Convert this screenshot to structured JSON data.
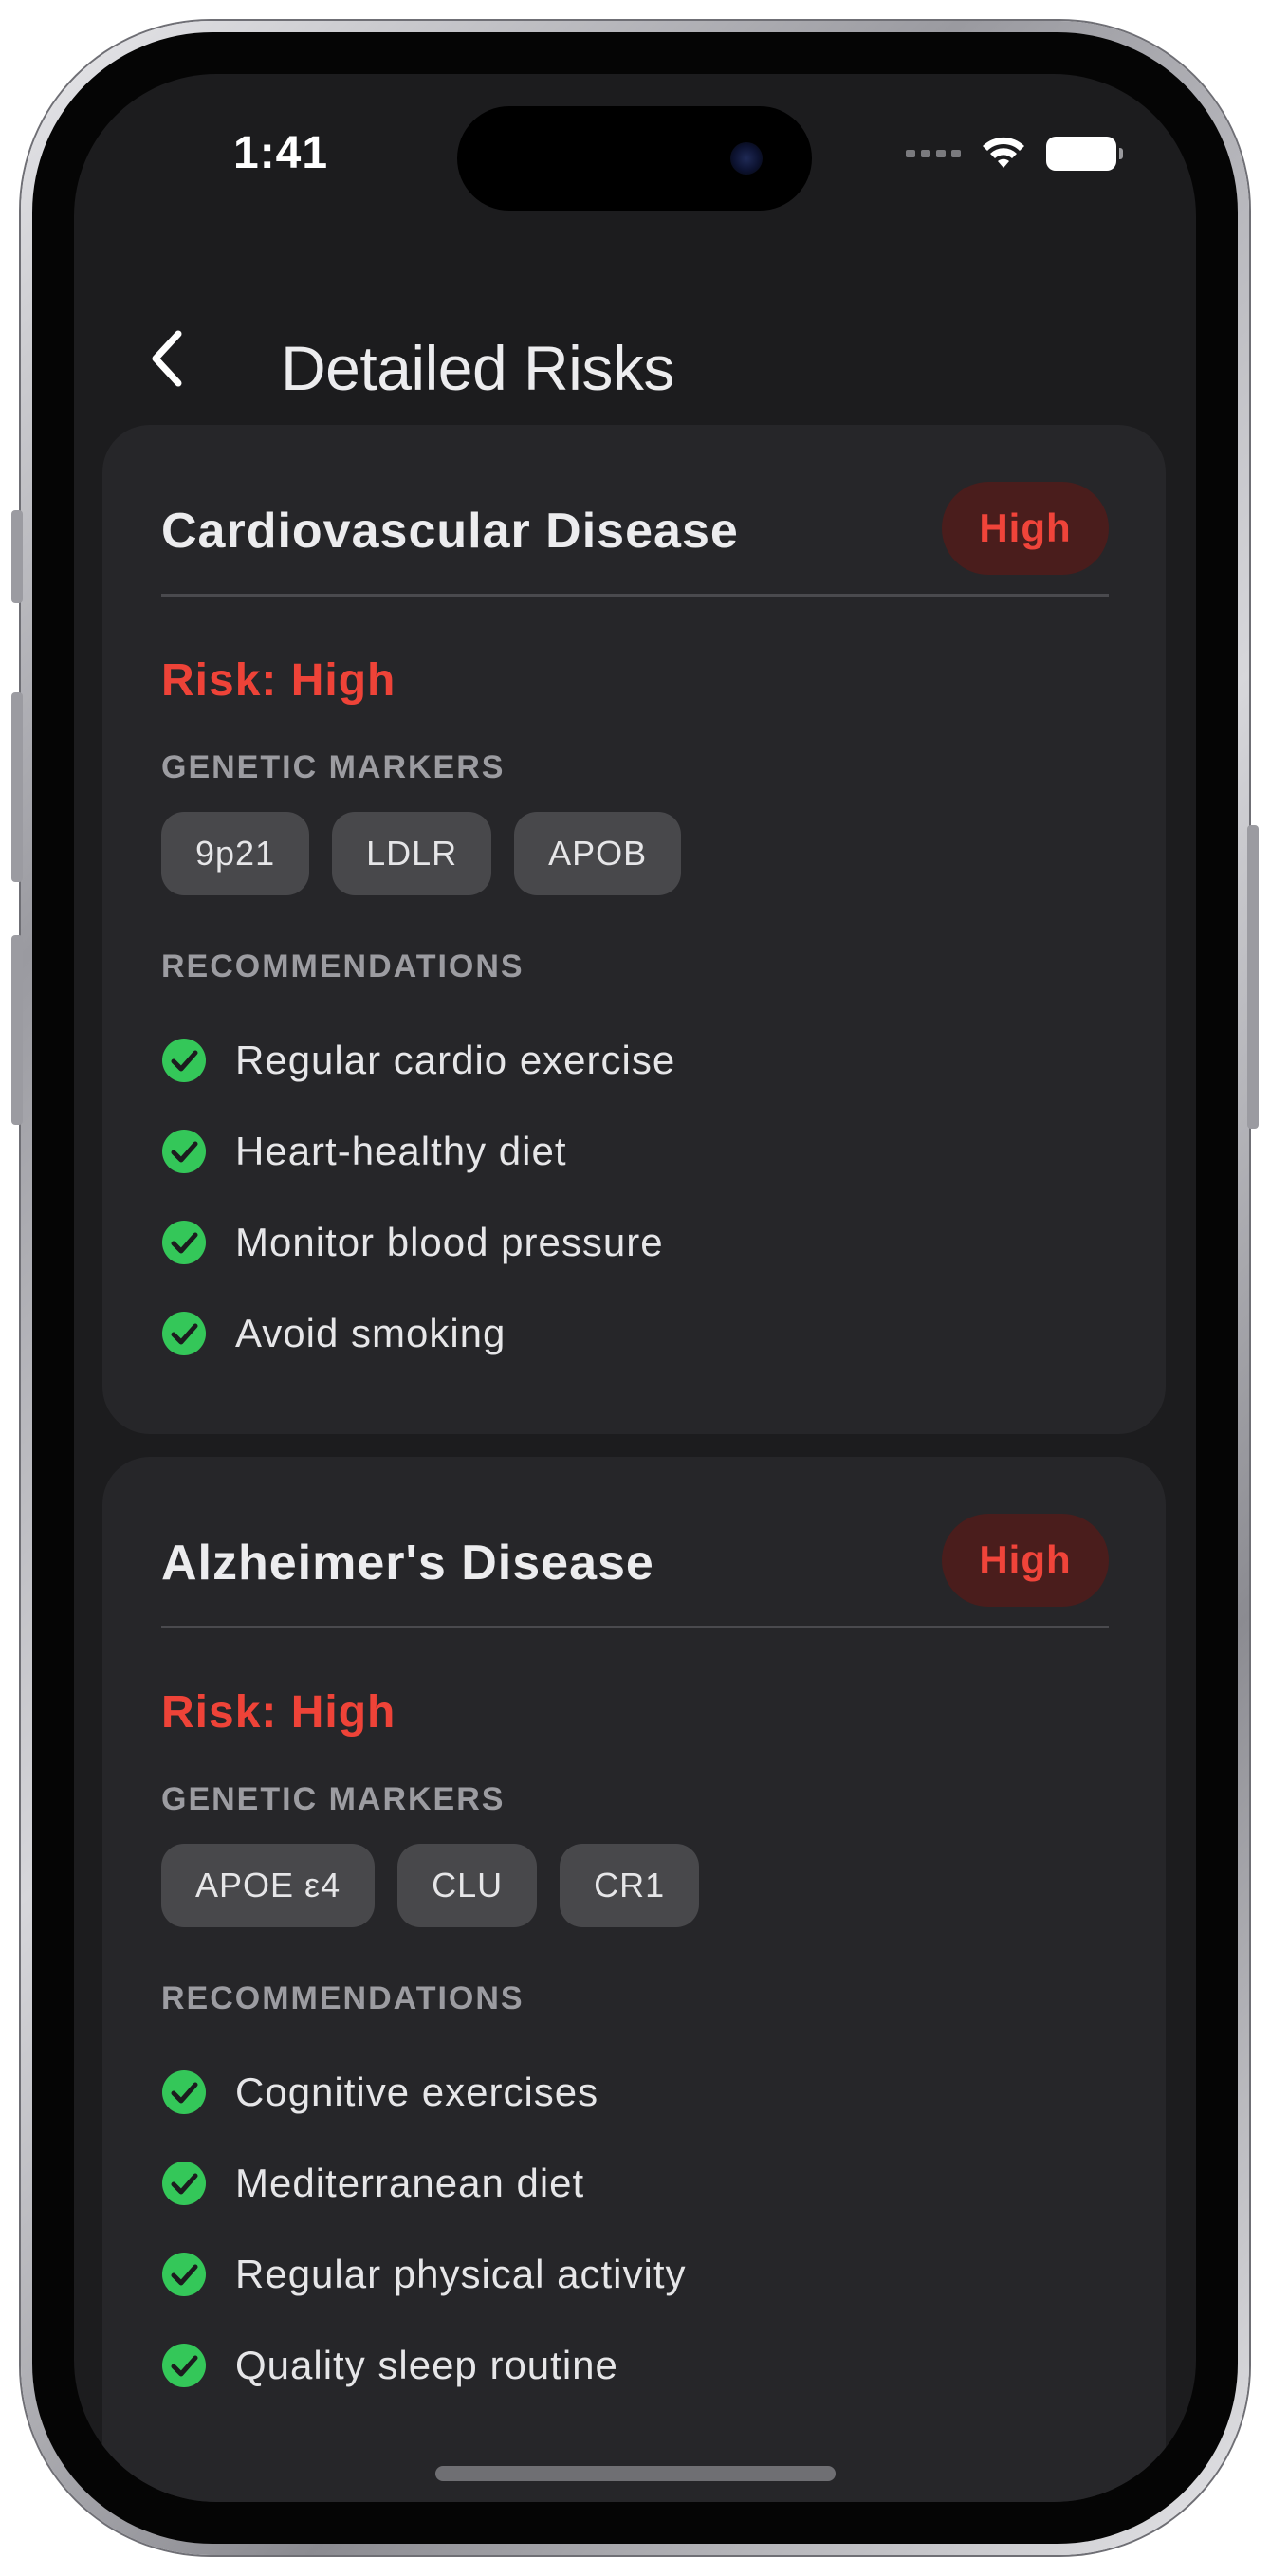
{
  "status_bar": {
    "time": "1:41"
  },
  "nav": {
    "title": "Detailed Risks"
  },
  "cards": [
    {
      "title": "Cardiovascular Disease",
      "badge": "High",
      "risk_text": "Risk: High",
      "markers_label": "GENETIC MARKERS",
      "markers": [
        "9p21",
        "LDLR",
        "APOB"
      ],
      "recommendations_label": "RECOMMENDATIONS",
      "recommendations": [
        "Regular cardio exercise",
        "Heart-healthy diet",
        "Monitor blood pressure",
        "Avoid smoking"
      ]
    },
    {
      "title": "Alzheimer's Disease",
      "badge": "High",
      "risk_text": "Risk: High",
      "markers_label": "GENETIC MARKERS",
      "markers": [
        "APOE ε4",
        "CLU",
        "CR1"
      ],
      "recommendations_label": "RECOMMENDATIONS",
      "recommendations": [
        "Cognitive exercises",
        "Mediterranean diet",
        "Regular physical activity",
        "Quality sleep routine"
      ]
    }
  ],
  "colors": {
    "background": "#1c1c1e",
    "card": "#262629",
    "risk_high": "#f0443a",
    "badge_bg": "#4a1d1c",
    "check": "#34c759",
    "chip": "#48484b"
  },
  "icons": {
    "back": "chevron-left-icon",
    "check": "checkmark-circle-icon",
    "wifi": "wifi-icon",
    "battery": "battery-icon"
  }
}
